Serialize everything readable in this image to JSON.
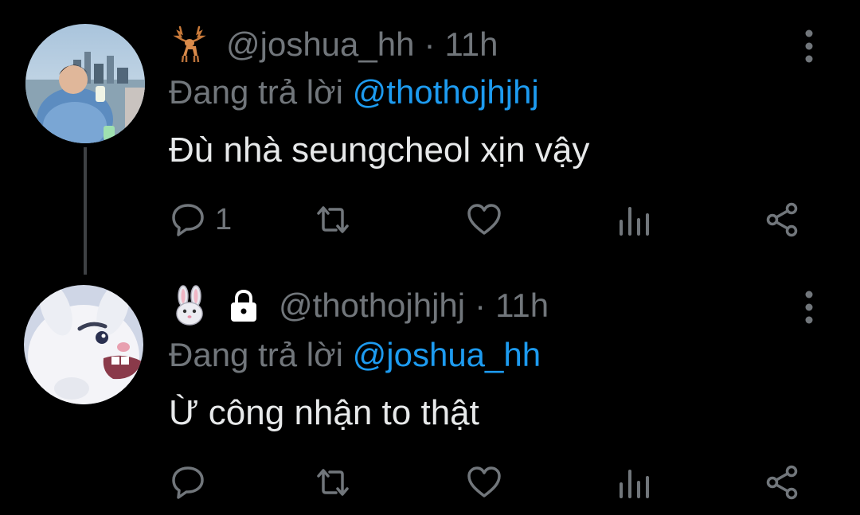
{
  "tweets": [
    {
      "handle": "@joshua_hh",
      "separator": "·",
      "time": "11h",
      "reply_prefix": "Đang trả lời",
      "reply_to": "@thothojhjhj",
      "text": "Đù nhà seungcheol xịn vậy",
      "reply_count": "1",
      "name_emoji": "deer-emoji"
    },
    {
      "handle": "@thothojhjhj",
      "separator": "·",
      "time": "11h",
      "reply_prefix": "Đang trả lời",
      "reply_to": "@joshua_hh",
      "text": "Ừ công nhận to thật",
      "reply_count": "",
      "name_emoji": "rabbit-emoji",
      "protected": true
    }
  ],
  "colors": {
    "background": "#000000",
    "secondary_text": "#71767b",
    "primary_text": "#e7e9ea",
    "mention": "#1d9bf0",
    "thread_line": "#3e4144"
  }
}
